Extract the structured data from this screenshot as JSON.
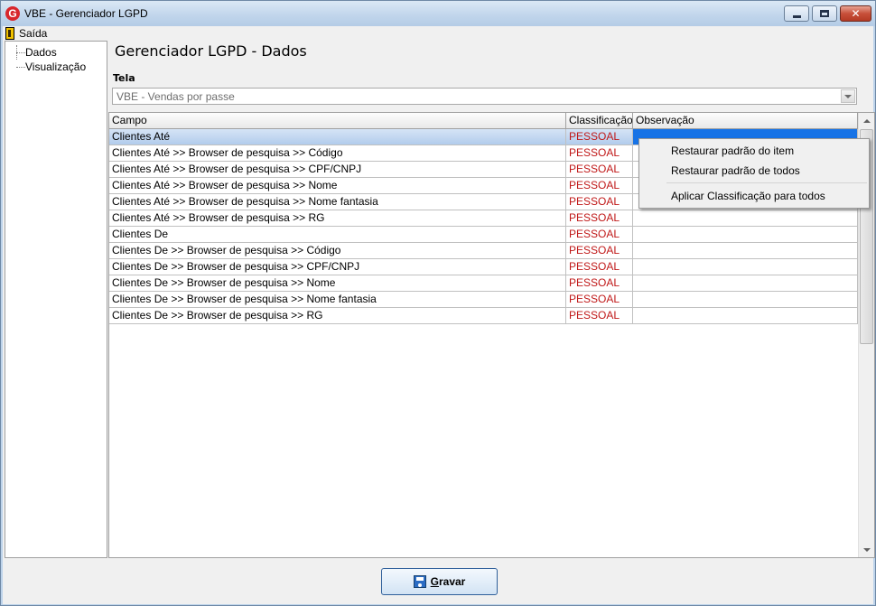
{
  "window": {
    "title": "VBE - Gerenciador LGPD",
    "app_icon_letter": "G",
    "close_glyph": "✕"
  },
  "menu": {
    "exit_label": "Saída"
  },
  "tree": {
    "items": [
      {
        "label": "Dados"
      },
      {
        "label": "Visualização"
      }
    ]
  },
  "main": {
    "page_title": "Gerenciador LGPD - Dados",
    "tela_label": "Tela",
    "tela_value": "VBE - Vendas por passe"
  },
  "grid": {
    "columns": [
      "Campo",
      "Classificação",
      "Observação"
    ],
    "selected_row": 0,
    "rows": [
      {
        "campo": "Clientes Até",
        "classificacao": "PESSOAL",
        "observacao": ""
      },
      {
        "campo": "Clientes Até >> Browser de pesquisa >> Código",
        "classificacao": "PESSOAL",
        "observacao": ""
      },
      {
        "campo": "Clientes Até >> Browser de pesquisa >> CPF/CNPJ",
        "classificacao": "PESSOAL",
        "observacao": ""
      },
      {
        "campo": "Clientes Até >> Browser de pesquisa >> Nome",
        "classificacao": "PESSOAL",
        "observacao": ""
      },
      {
        "campo": "Clientes Até >> Browser de pesquisa >> Nome fantasia",
        "classificacao": "PESSOAL",
        "observacao": ""
      },
      {
        "campo": "Clientes Até >> Browser de pesquisa >> RG",
        "classificacao": "PESSOAL",
        "observacao": ""
      },
      {
        "campo": "Clientes De",
        "classificacao": "PESSOAL",
        "observacao": ""
      },
      {
        "campo": "Clientes De >> Browser de pesquisa >> Código",
        "classificacao": "PESSOAL",
        "observacao": ""
      },
      {
        "campo": "Clientes De >> Browser de pesquisa >> CPF/CNPJ",
        "classificacao": "PESSOAL",
        "observacao": ""
      },
      {
        "campo": "Clientes De >> Browser de pesquisa >> Nome",
        "classificacao": "PESSOAL",
        "observacao": ""
      },
      {
        "campo": "Clientes De >> Browser de pesquisa >> Nome fantasia",
        "classificacao": "PESSOAL",
        "observacao": ""
      },
      {
        "campo": "Clientes De >> Browser de pesquisa >> RG",
        "classificacao": "PESSOAL",
        "observacao": ""
      }
    ]
  },
  "context_menu": {
    "items": [
      "Restaurar padrão do item",
      "Restaurar padrão de todos",
      "Aplicar Classificação para todos"
    ]
  },
  "footer": {
    "save_label_first": "G",
    "save_label_rest": "ravar"
  },
  "colors": {
    "classification_text": "#c01818",
    "selection_blue": "#1773e6",
    "title_bar": "#c2d6ec"
  }
}
